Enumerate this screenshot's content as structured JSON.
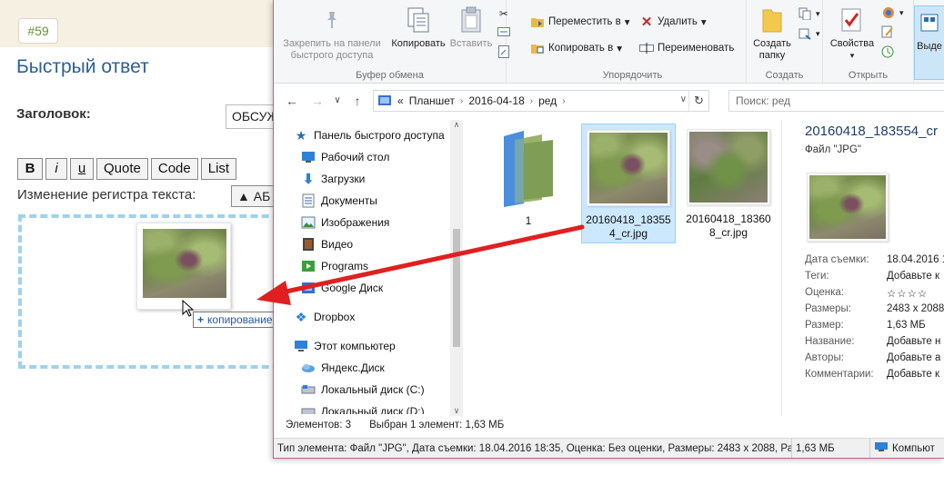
{
  "forum": {
    "post_number": "#59",
    "quick_reply_title": "Быстрый ответ",
    "subject_label": "Заголовок:",
    "subject_value": "ОБСУЖ",
    "bb_buttons": {
      "bold": "B",
      "italic": "i",
      "underline": "u",
      "quote": "Quote",
      "code": "Code",
      "list": "List"
    },
    "case_label": "Изменение регистра текста:",
    "case_button": "▲ АБ",
    "copy_tooltip": {
      "plus": "+",
      "label": "копирование"
    }
  },
  "explorer": {
    "ribbon": {
      "clipboard": {
        "group_label": "Буфер обмена",
        "pin_label": "Закрепить на панели быстрого доступа",
        "copy_label": "Копировать",
        "paste_label": "Вставить"
      },
      "organize": {
        "group_label": "Упорядочить",
        "move_label": "Переместить в",
        "copyto_label": "Копировать в",
        "delete_label": "Удалить",
        "rename_label": "Переименовать"
      },
      "new": {
        "group_label": "Создать",
        "new_folder_label": "Создать папку"
      },
      "open": {
        "group_label": "Открыть",
        "properties_label": "Свойства"
      },
      "select": {
        "label": "Выде"
      }
    },
    "address": {
      "crumbs": [
        "«",
        "Планшет",
        "2016-04-18",
        "ред"
      ],
      "search_placeholder": "Поиск: ред"
    },
    "nav": {
      "items": [
        {
          "label": "Панель быстрого доступа",
          "icon": "star-icon",
          "pinned": false
        },
        {
          "label": "Рабочий стол",
          "icon": "desktop-icon",
          "pinned": true
        },
        {
          "label": "Загрузки",
          "icon": "download-icon",
          "pinned": true
        },
        {
          "label": "Документы",
          "icon": "documents-icon",
          "pinned": true
        },
        {
          "label": "Изображения",
          "icon": "pictures-icon",
          "pinned": true
        },
        {
          "label": "Видео",
          "icon": "video-icon",
          "pinned": true
        },
        {
          "label": "Programs",
          "icon": "programs-icon",
          "pinned": true
        },
        {
          "label": "Google Диск",
          "icon": "google-drive-icon",
          "pinned": true
        },
        {
          "label": "Dropbox",
          "icon": "dropbox-icon",
          "pinned": false
        },
        {
          "label": "Этот компьютер",
          "icon": "computer-icon",
          "pinned": false
        },
        {
          "label": "Яндекс.Диск",
          "icon": "yandex-disk-icon",
          "pinned": false
        },
        {
          "label": "Локальный диск (C:)",
          "icon": "drive-icon",
          "pinned": false
        },
        {
          "label": "Локальный диск (D:)",
          "icon": "drive-icon",
          "pinned": false
        }
      ]
    },
    "files": [
      {
        "name": "1",
        "kind": "folder"
      },
      {
        "name": "20160418_183554_cr.jpg",
        "kind": "image",
        "selected": true
      },
      {
        "name": "20160418_183608_cr.jpg",
        "kind": "image",
        "selected": false
      }
    ],
    "details": {
      "filename": "20160418_183554_cr",
      "filetype": "Файл \"JPG\"",
      "props": [
        {
          "k": "Дата съемки:",
          "v": "18.04.2016 1"
        },
        {
          "k": "Теги:",
          "v": "Добавьте к"
        },
        {
          "k": "Оценка:",
          "v": "☆☆☆☆"
        },
        {
          "k": "Размеры:",
          "v": "2483 x 2088"
        },
        {
          "k": "Размер:",
          "v": "1,63 МБ"
        },
        {
          "k": "Название:",
          "v": "Добавьте н"
        },
        {
          "k": "Авторы:",
          "v": "Добавьте а"
        },
        {
          "k": "Комментарии:",
          "v": "Добавьте к"
        }
      ]
    },
    "status": {
      "count": "Элементов: 3",
      "selection": "Выбран 1 элемент: 1,63 МБ"
    },
    "infobar": {
      "type_info": "Тип элемента: Файл \"JPG\", Дата съемки: 18.04.2016 18:35, Оценка: Без оценки, Размеры: 2483 x 2088, Раз",
      "size": "1,63 МБ",
      "location": "Компьют"
    }
  },
  "colors": {
    "accent": "#1e5aa8",
    "arrow": "#e02020",
    "selection": "#cce8ff",
    "dashed_border": "#9fd2ec"
  }
}
